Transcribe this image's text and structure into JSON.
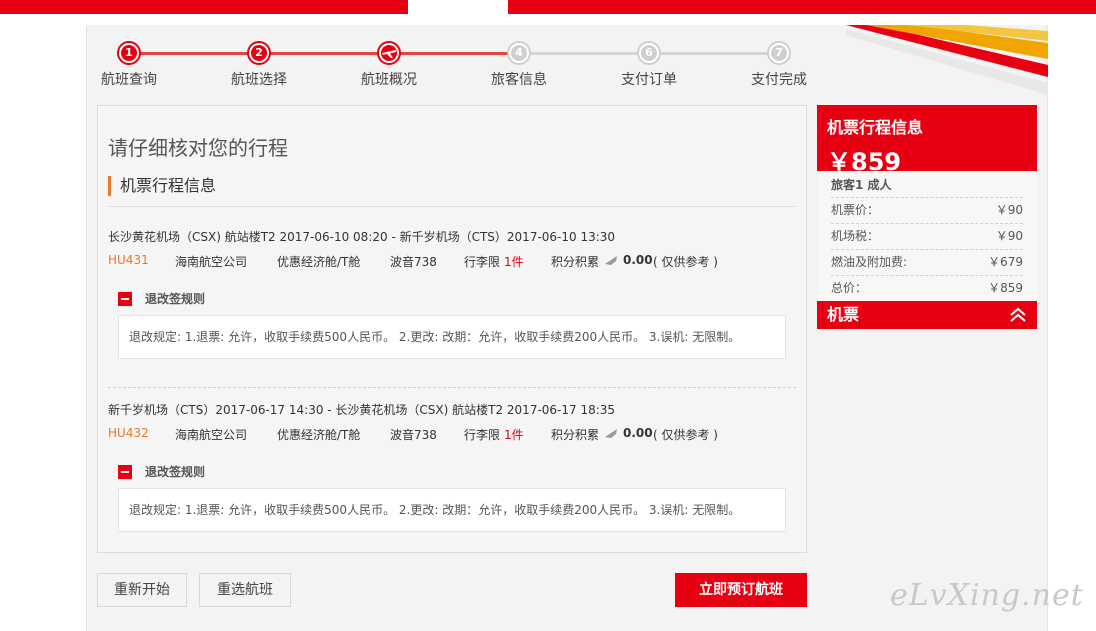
{
  "steps": [
    {
      "num": "1",
      "label": "航班查询",
      "active": true
    },
    {
      "num": "2",
      "label": "航班选择",
      "active": true
    },
    {
      "num": "",
      "label": "航班概况",
      "active": true,
      "icon": "plane-icon"
    },
    {
      "num": "4",
      "label": "旅客信息",
      "active": false
    },
    {
      "num": "6",
      "label": "支付订单",
      "active": false
    },
    {
      "num": "7",
      "label": "支付完成",
      "active": false
    }
  ],
  "main": {
    "title": "请仔细核对您的行程",
    "section_title": "机票行程信息",
    "flights": [
      {
        "route": "长沙黄花机场（CSX) 航站楼T2 2017-06-10 08:20 - 新千岁机场（CTS）2017-06-10 13:30",
        "flight_no": "HU431",
        "airline": "海南航空公司",
        "cabin": "优惠经济舱/T舱",
        "aircraft": "波音738",
        "baggage_label": "行李限",
        "baggage_value": "1件",
        "points_label": "积分积累",
        "points_value": "0.00",
        "points_note": "( 仅供参考 )",
        "rule_title": "退改签规则",
        "rule_text": "退改规定: 1.退票: 允许，收取手续费500人民币。 2.更改: 改期：允许，收取手续费200人民币。 3.误机: 无限制。"
      },
      {
        "route": "新千岁机场（CTS）2017-06-17 14:30 - 长沙黄花机场（CSX) 航站楼T2 2017-06-17 18:35",
        "flight_no": "HU432",
        "airline": "海南航空公司",
        "cabin": "优惠经济舱/T舱",
        "aircraft": "波音738",
        "baggage_label": "行李限",
        "baggage_value": "1件",
        "points_label": "积分积累",
        "points_value": "0.00",
        "points_note": "( 仅供参考 )",
        "rule_title": "退改签规则",
        "rule_text": "退改规定: 1.退票: 允许，收取手续费500人民币。 2.更改: 改期：允许，收取手续费200人民币。 3.误机: 无限制。"
      }
    ]
  },
  "sidebar": {
    "title": "机票行程信息",
    "price": "￥859",
    "passenger": "旅客1  成人",
    "rows": [
      {
        "label": "机票价：",
        "value": "￥90"
      },
      {
        "label": "机场税：",
        "value": "￥90"
      },
      {
        "label": "燃油及附加费:",
        "value": "￥679"
      },
      {
        "label": "总价：",
        "value": "￥859"
      }
    ],
    "footer": "机票"
  },
  "buttons": {
    "restart": "重新开始",
    "reselect": "重选航班",
    "book": "立即预订航班"
  },
  "watermark": "eLvXing.net",
  "colors": {
    "brand_red": "#e60012",
    "accent_orange": "#e8792b"
  }
}
